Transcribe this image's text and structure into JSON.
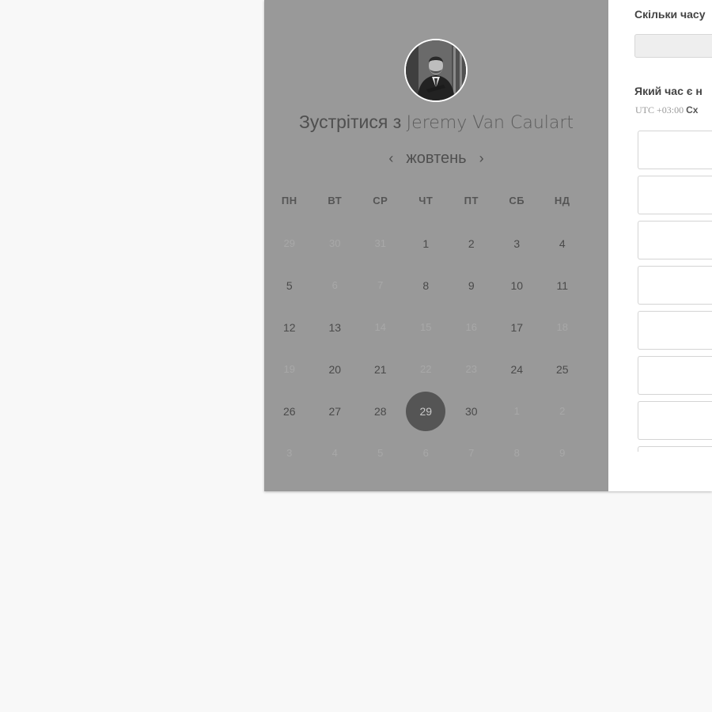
{
  "booking": {
    "meet_prefix": "Зустрітися з",
    "host_name": "Jeremy Van Caulart",
    "month": "жовтень",
    "prev_arrow": "‹",
    "next_arrow": "›",
    "weekdays": [
      "ПН",
      "ВТ",
      "СР",
      "ЧТ",
      "ПТ",
      "СБ",
      "НД"
    ],
    "weeks": [
      [
        {
          "d": "29",
          "s": "unavailable"
        },
        {
          "d": "30",
          "s": "unavailable"
        },
        {
          "d": "31",
          "s": "unavailable"
        },
        {
          "d": "1",
          "s": "available"
        },
        {
          "d": "2",
          "s": "available"
        },
        {
          "d": "3",
          "s": "available"
        },
        {
          "d": "4",
          "s": "available"
        }
      ],
      [
        {
          "d": "5",
          "s": "available"
        },
        {
          "d": "6",
          "s": "unavailable"
        },
        {
          "d": "7",
          "s": "unavailable"
        },
        {
          "d": "8",
          "s": "available"
        },
        {
          "d": "9",
          "s": "available"
        },
        {
          "d": "10",
          "s": "available"
        },
        {
          "d": "11",
          "s": "available"
        }
      ],
      [
        {
          "d": "12",
          "s": "available"
        },
        {
          "d": "13",
          "s": "available"
        },
        {
          "d": "14",
          "s": "unavailable"
        },
        {
          "d": "15",
          "s": "unavailable"
        },
        {
          "d": "16",
          "s": "unavailable"
        },
        {
          "d": "17",
          "s": "available"
        },
        {
          "d": "18",
          "s": "unavailable"
        }
      ],
      [
        {
          "d": "19",
          "s": "unavailable"
        },
        {
          "d": "20",
          "s": "available"
        },
        {
          "d": "21",
          "s": "available"
        },
        {
          "d": "22",
          "s": "unavailable"
        },
        {
          "d": "23",
          "s": "unavailable"
        },
        {
          "d": "24",
          "s": "available"
        },
        {
          "d": "25",
          "s": "available"
        }
      ],
      [
        {
          "d": "26",
          "s": "available"
        },
        {
          "d": "27",
          "s": "available"
        },
        {
          "d": "28",
          "s": "available"
        },
        {
          "d": "29",
          "s": "selected"
        },
        {
          "d": "30",
          "s": "available"
        },
        {
          "d": "1",
          "s": "unavailable"
        },
        {
          "d": "2",
          "s": "unavailable"
        }
      ],
      [
        {
          "d": "3",
          "s": "unavailable"
        },
        {
          "d": "4",
          "s": "unavailable"
        },
        {
          "d": "5",
          "s": "unavailable"
        },
        {
          "d": "6",
          "s": "unavailable"
        },
        {
          "d": "7",
          "s": "unavailable"
        },
        {
          "d": "8",
          "s": "unavailable"
        },
        {
          "d": "9",
          "s": "unavailable"
        }
      ]
    ],
    "duration_question": "Скільки часу",
    "time_question": "Який час є н",
    "timezone_offset": "UTC +03:00",
    "timezone_name": "Сх",
    "time_slot_count_visible": 8,
    "colors": {
      "overlay_panel": "#999999",
      "selected_day": "#555555",
      "page_background": "#f8f8f8"
    }
  }
}
